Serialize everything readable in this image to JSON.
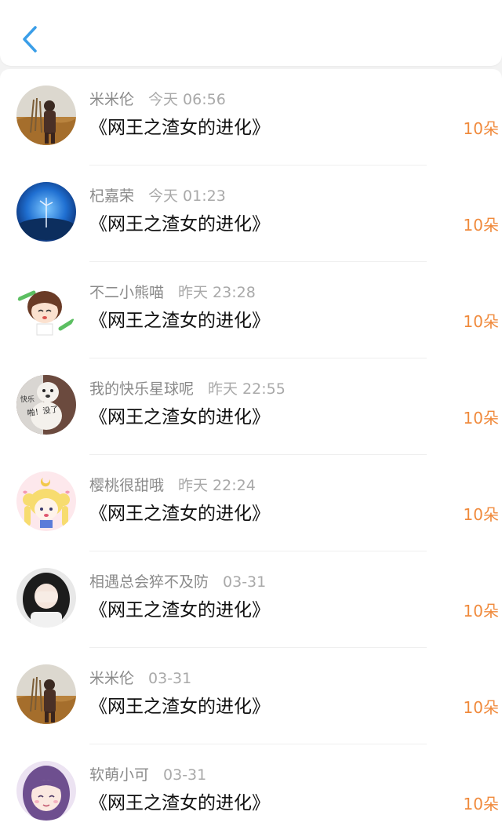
{
  "header": {
    "back_icon": "chevron-left-icon",
    "accent_color": "#3a9ee8"
  },
  "gift_color": "#f08a3c",
  "items": [
    {
      "name": "米米伦",
      "time": "今天 06:56",
      "title": "《网王之渣女的进化》",
      "amount": "10朵",
      "avatar": "man-in-field-avatar"
    },
    {
      "name": "杞嘉荣",
      "time": "今天 01:23",
      "title": "《网王之渣女的进化》",
      "amount": "10朵",
      "avatar": "blue-globe-avatar"
    },
    {
      "name": "不二小熊喵",
      "time": "昨天 23:28",
      "title": "《网王之渣女的进化》",
      "amount": "10朵",
      "avatar": "anime-boy-avatar"
    },
    {
      "name": "我的快乐星球呢",
      "time": "昨天 22:55",
      "title": "《网王之渣女的进化》",
      "amount": "10朵",
      "avatar": "dog-meme-avatar",
      "avatar_text_1": "快乐",
      "avatar_text_2": "啪！没了"
    },
    {
      "name": "樱桃很甜哦",
      "time": "昨天 22:24",
      "title": "《网王之渣女的进化》",
      "amount": "10朵",
      "avatar": "sailor-moon-avatar"
    },
    {
      "name": "相遇总会猝不及防",
      "time": "03-31",
      "title": "《网王之渣女的进化》",
      "amount": "10朵",
      "avatar": "girl-covering-face-avatar"
    },
    {
      "name": "米米伦",
      "time": "03-31",
      "title": "《网王之渣女的进化》",
      "amount": "10朵",
      "avatar": "man-in-field-avatar"
    },
    {
      "name": "软萌小可",
      "time": "03-31",
      "title": "《网王之渣女的进化》",
      "amount": "10朵",
      "avatar": "purple-hair-girl-avatar"
    }
  ]
}
